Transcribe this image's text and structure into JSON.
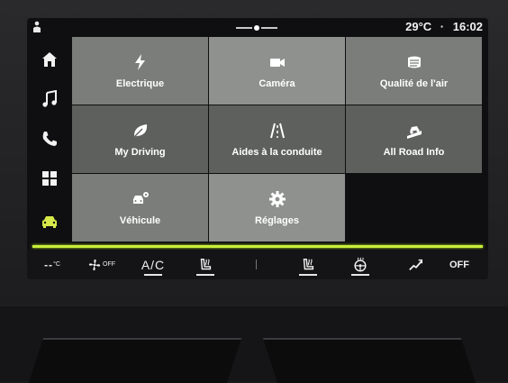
{
  "status": {
    "temperature": "29°C",
    "separator": "·",
    "time": "16:02"
  },
  "sidebar": {
    "items": [
      {
        "icon": "home-icon",
        "active": false
      },
      {
        "icon": "music-note-icon",
        "active": false
      },
      {
        "icon": "phone-icon",
        "active": false
      },
      {
        "icon": "apps-grid-icon",
        "active": false
      },
      {
        "icon": "car-icon",
        "active": true
      }
    ]
  },
  "tiles": [
    {
      "label": "Electrique",
      "icon": "lightning-icon"
    },
    {
      "label": "Caméra",
      "icon": "camera-icon"
    },
    {
      "label": "Qualité de l'air",
      "icon": "air-quality-icon"
    },
    {
      "label": "My Driving",
      "icon": "leaf-icon"
    },
    {
      "label": "Aides à la conduite",
      "icon": "lane-assist-icon"
    },
    {
      "label": "All Road Info",
      "icon": "road-info-icon"
    },
    {
      "label": "Véhicule",
      "icon": "vehicle-settings-icon"
    },
    {
      "label": "Réglages",
      "icon": "gear-icon"
    }
  ],
  "climate": {
    "temp_left": "--",
    "temp_unit": "°C",
    "fan_status": "OFF",
    "ac_label": "A/C",
    "right_off_label": "OFF"
  },
  "colors": {
    "accent": "#c9f03a",
    "active_icon": "#d6e84a"
  }
}
